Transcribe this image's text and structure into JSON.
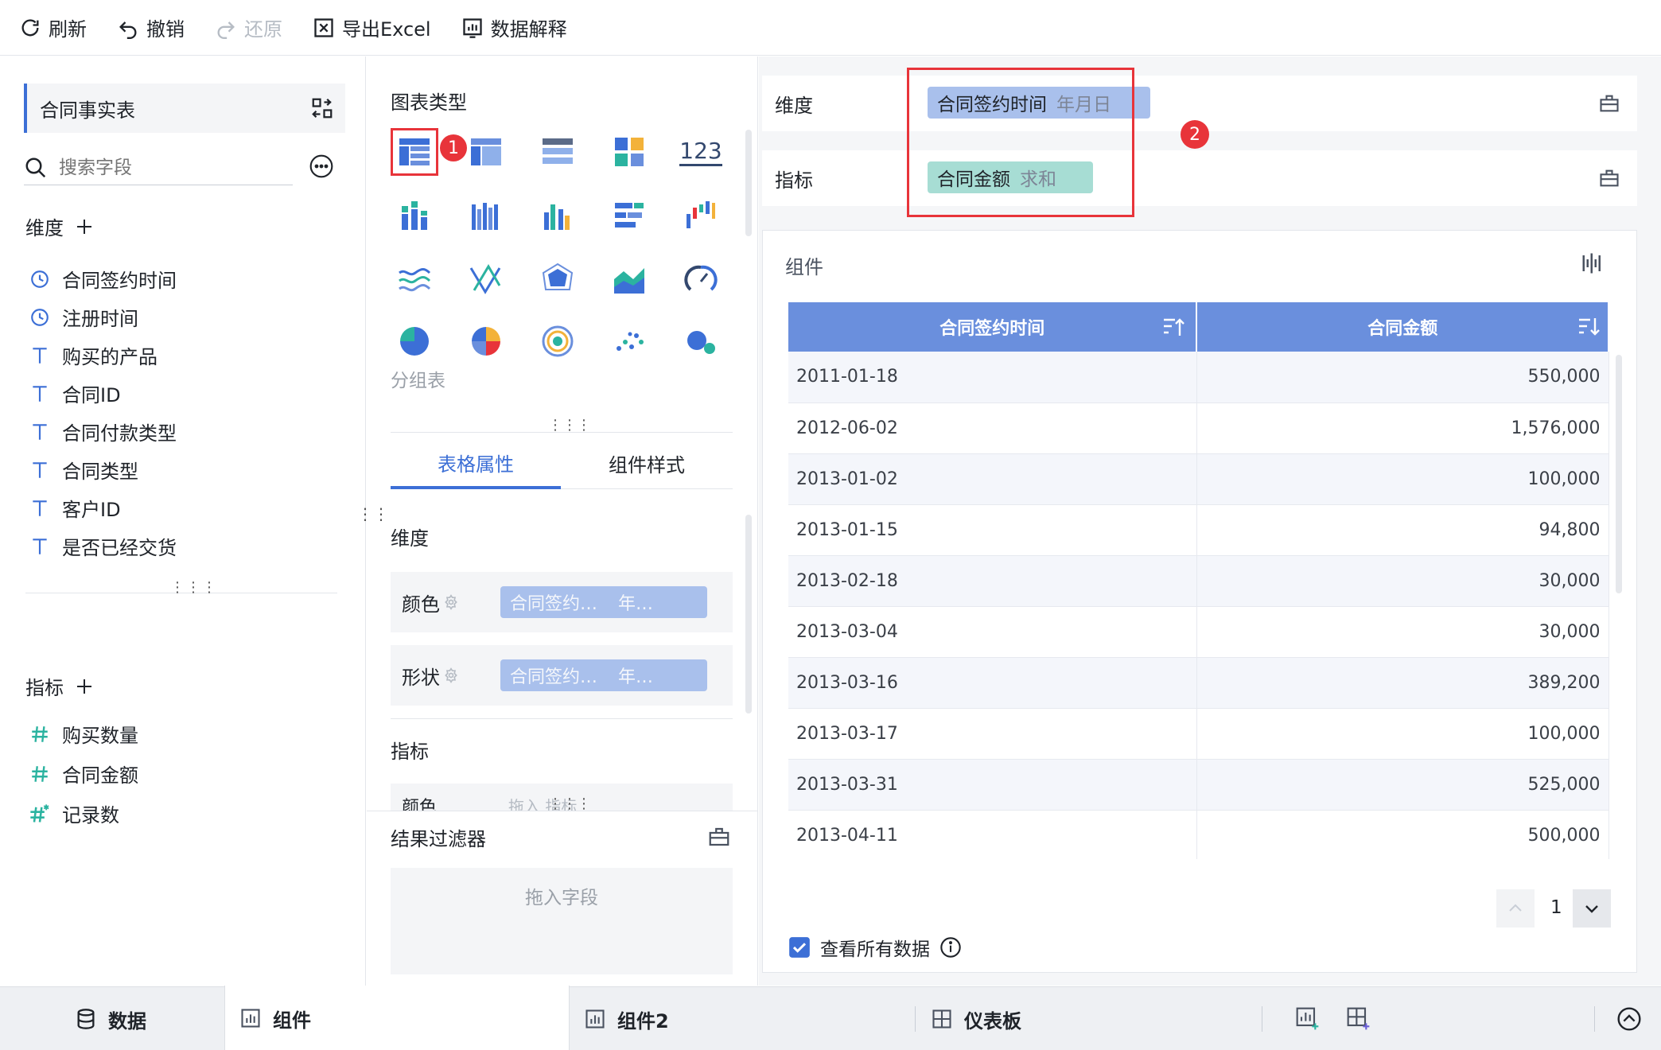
{
  "toolbar": {
    "refresh": "刷新",
    "undo": "撤销",
    "redo": "还原",
    "export": "导出Excel",
    "explain": "数据解释"
  },
  "left": {
    "table_name": "合同事实表",
    "search_placeholder": "搜索字段",
    "dim_title": "维度",
    "dimensions": [
      {
        "icon": "clock-icon",
        "label": "合同签约时间"
      },
      {
        "icon": "clock-icon",
        "label": "注册时间"
      },
      {
        "icon": "text-icon",
        "label": "购买的产品"
      },
      {
        "icon": "text-icon",
        "label": "合同ID"
      },
      {
        "icon": "text-icon",
        "label": "合同付款类型"
      },
      {
        "icon": "text-icon",
        "label": "合同类型"
      },
      {
        "icon": "text-icon",
        "label": "客户ID"
      },
      {
        "icon": "text-icon",
        "label": "是否已经交货"
      }
    ],
    "metric_title": "指标",
    "metrics": [
      {
        "icon": "hash-icon",
        "label": "购买数量"
      },
      {
        "icon": "hash-icon",
        "label": "合同金额"
      },
      {
        "icon": "hash-star-icon",
        "label": "记录数"
      }
    ]
  },
  "mid": {
    "chart_type_title": "图表类型",
    "chart_123": "123",
    "selected_chart_name": "分组表",
    "badge1": "1",
    "tab_table_props": "表格属性",
    "tab_component_style": "组件样式",
    "dim_title": "维度",
    "color_label": "颜色",
    "shape_label": "形状",
    "color_field": "合同签约…",
    "color_field_sub": "年…",
    "shape_field": "合同签约…",
    "shape_field_sub": "年…",
    "metric_title": "指标",
    "metric_color_label": "颜色",
    "metric_color_hint": "拖入 指标",
    "filter_title": "结果过滤器",
    "filter_drop_hint": "拖入字段"
  },
  "right": {
    "dim_label": "维度",
    "metric_label": "指标",
    "dim_field": "合同签约时间",
    "dim_field_sub": "年月日",
    "metric_field": "合同金额",
    "metric_field_sub": "求和",
    "badge2": "2",
    "component_title": "组件",
    "table_headers": [
      "合同签约时间",
      "合同金额"
    ],
    "rows": [
      [
        "2011-01-18",
        "550,000"
      ],
      [
        "2012-06-02",
        "1,576,000"
      ],
      [
        "2013-01-02",
        "100,000"
      ],
      [
        "2013-01-15",
        "94,800"
      ],
      [
        "2013-02-18",
        "30,000"
      ],
      [
        "2013-03-04",
        "30,000"
      ],
      [
        "2013-03-16",
        "389,200"
      ],
      [
        "2013-03-17",
        "100,000"
      ],
      [
        "2013-03-31",
        "525,000"
      ],
      [
        "2013-04-11",
        "500,000"
      ]
    ],
    "page_number": "1",
    "view_all_label": "查看所有数据"
  },
  "bottom": {
    "data_tab": "数据",
    "component_tab": "组件",
    "component2_tab": "组件2",
    "dashboard_tab": "仪表板"
  },
  "colors": {
    "accent": "#3c6fd6",
    "header": "#6a8fdd",
    "badge": "#e8343a",
    "teal": "#2bb3a0"
  }
}
